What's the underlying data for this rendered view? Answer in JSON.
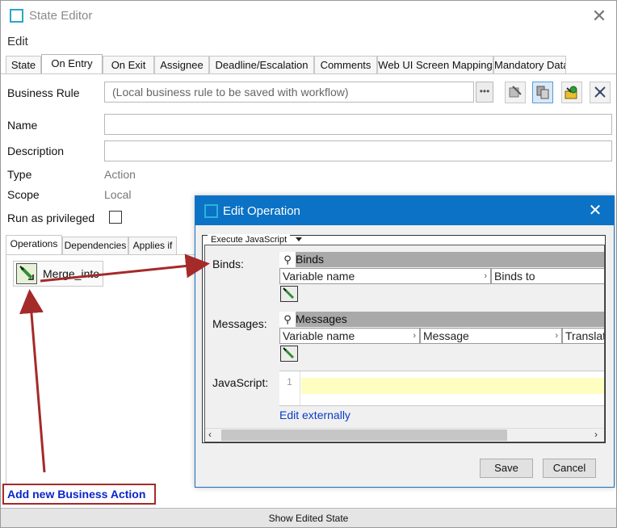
{
  "colors": {
    "accent": "#0b72c6",
    "annotation": "#a52a2a",
    "link": "#0b3bc8",
    "highlight": "#fefec0"
  },
  "state_editor": {
    "title": "State Editor",
    "menu_edit": "Edit",
    "tabs": [
      {
        "label": "State"
      },
      {
        "label": "On Entry",
        "active": true
      },
      {
        "label": "On Exit"
      },
      {
        "label": "Assignee"
      },
      {
        "label": "Deadline/Escalation"
      },
      {
        "label": "Comments"
      },
      {
        "label": "Web UI Screen Mapping"
      },
      {
        "label": "Mandatory Data"
      }
    ],
    "fields": {
      "business_rule_label": "Business Rule",
      "business_rule_placeholder": "(Local business rule to be saved with workflow)",
      "name_label": "Name",
      "description_label": "Description",
      "type_label": "Type",
      "type_value": "Action",
      "scope_label": "Scope",
      "scope_value": "Local",
      "privileged_label": "Run as privileged"
    },
    "toolbar_icons": [
      "copy-rule-icon",
      "duplicate-icon",
      "plugin-icon",
      "tools-icon"
    ],
    "subtabs": [
      {
        "label": "Operations",
        "active": true
      },
      {
        "label": "Dependencies"
      },
      {
        "label": "Applies if"
      }
    ],
    "operation_item": "Merge_into",
    "add_action": "Add new Business Action",
    "show_edited": "Show Edited State"
  },
  "edit_operation": {
    "title": "Edit Operation",
    "operation_type": "Execute JavaScript",
    "binds_label": "Binds:",
    "binds_header": "Binds",
    "binds_columns": [
      "Variable name",
      "Binds to"
    ],
    "messages_label": "Messages:",
    "messages_header": "Messages",
    "messages_columns": [
      "Variable name",
      "Message",
      "Translat"
    ],
    "javascript_label": "JavaScript:",
    "line_number": "1",
    "edit_externally": "Edit externally",
    "save": "Save",
    "cancel": "Cancel"
  }
}
